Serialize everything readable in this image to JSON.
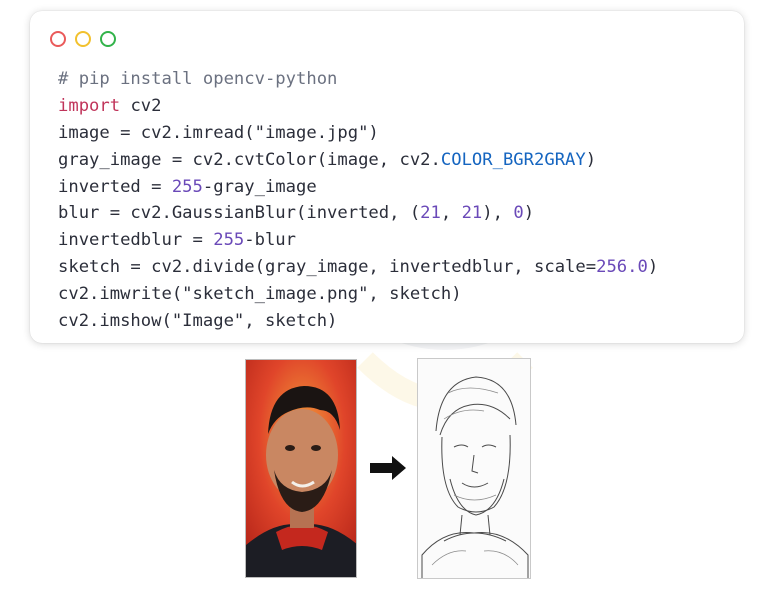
{
  "window": {
    "buttons": [
      "close",
      "minimize",
      "maximize"
    ],
    "colors": {
      "close": "#ea5a5a",
      "minimize": "#f2c12e",
      "maximize": "#32b34a"
    }
  },
  "code": {
    "lines": [
      [
        {
          "t": "# pip install opencv-python",
          "k": "comment"
        }
      ],
      [
        {
          "t": "import",
          "k": "kw"
        },
        {
          "t": " cv2",
          "k": "plain"
        }
      ],
      [
        {
          "t": "image = cv2.imread(\"image.jpg\")",
          "k": "plain"
        }
      ],
      [
        {
          "t": "gray_image = cv2.cvtColor(image, cv2.",
          "k": "plain"
        },
        {
          "t": "COLOR_BGR2GRAY",
          "k": "const"
        },
        {
          "t": ")",
          "k": "plain"
        }
      ],
      [
        {
          "t": "inverted = ",
          "k": "plain"
        },
        {
          "t": "255",
          "k": "num"
        },
        {
          "t": "-gray_image",
          "k": "plain"
        }
      ],
      [
        {
          "t": "blur = cv2.GaussianBlur(inverted, (",
          "k": "plain"
        },
        {
          "t": "21",
          "k": "num"
        },
        {
          "t": ", ",
          "k": "plain"
        },
        {
          "t": "21",
          "k": "num"
        },
        {
          "t": "), ",
          "k": "plain"
        },
        {
          "t": "0",
          "k": "num"
        },
        {
          "t": ")",
          "k": "plain"
        }
      ],
      [
        {
          "t": "invertedblur = ",
          "k": "plain"
        },
        {
          "t": "255",
          "k": "num"
        },
        {
          "t": "-blur",
          "k": "plain"
        }
      ],
      [
        {
          "t": "sketch = cv2.divide(gray_image, invertedblur, scale=",
          "k": "plain"
        },
        {
          "t": "256.0",
          "k": "num"
        },
        {
          "t": ")",
          "k": "plain"
        }
      ],
      [
        {
          "t": "cv2.imwrite(\"sketch_image.png\", sketch)",
          "k": "plain"
        }
      ],
      [
        {
          "t": "cv2.imshow(\"Image\", sketch)",
          "k": "plain"
        }
      ]
    ]
  },
  "images": {
    "original": "portrait-photo",
    "arrow": "right-arrow-icon",
    "result": "pencil-sketch"
  }
}
